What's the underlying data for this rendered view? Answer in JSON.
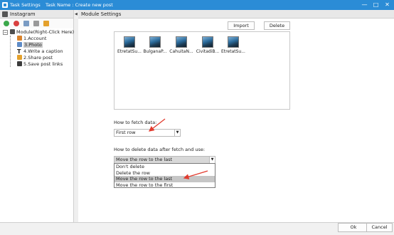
{
  "window": {
    "title": "Task Settings",
    "task_name": "Task Name : Create new post",
    "minimize": "—",
    "maximize": "□",
    "close": "✕"
  },
  "left_panel": {
    "header": "Instagram",
    "tree": {
      "root_label": "Module(Right-Click Here)",
      "items": [
        {
          "label": "1.Account",
          "icon": "account-icon",
          "color": "#d9822b"
        },
        {
          "label": "3.Photo",
          "icon": "photo-icon",
          "color": "#5e8bc7"
        },
        {
          "label": "4.Write a caption",
          "icon": "text-icon",
          "color": "#222222"
        },
        {
          "label": "2.Share post",
          "icon": "share-icon",
          "color": "#e4a12d"
        },
        {
          "label": "5.Save post links",
          "icon": "save-icon",
          "color": "#3c3c3c"
        }
      ]
    }
  },
  "main": {
    "header": "Module Settings",
    "import_label": "Import",
    "delete_label": "Delete",
    "photos": [
      "EtretatSu...",
      "BulganaP...",
      "CahuitaN...",
      "CivitadiB...",
      "EtretatSu..."
    ],
    "fetch_label": "How to fetch data:",
    "fetch_value": "First row",
    "delete_after_label": "How to delete data after fetch and use:",
    "delete_after_value": "Move the row to the last",
    "delete_options": [
      "Don't delete",
      "Delete the row",
      "Move the row to the last",
      "Move the row to the first"
    ],
    "highlighted_option_index": 2
  },
  "footer": {
    "ok_label": "Ok",
    "cancel_label": "Cancel"
  },
  "colors": {
    "titlebar": "#2b8cd6",
    "annotation_arrow": "#e23b2e"
  }
}
